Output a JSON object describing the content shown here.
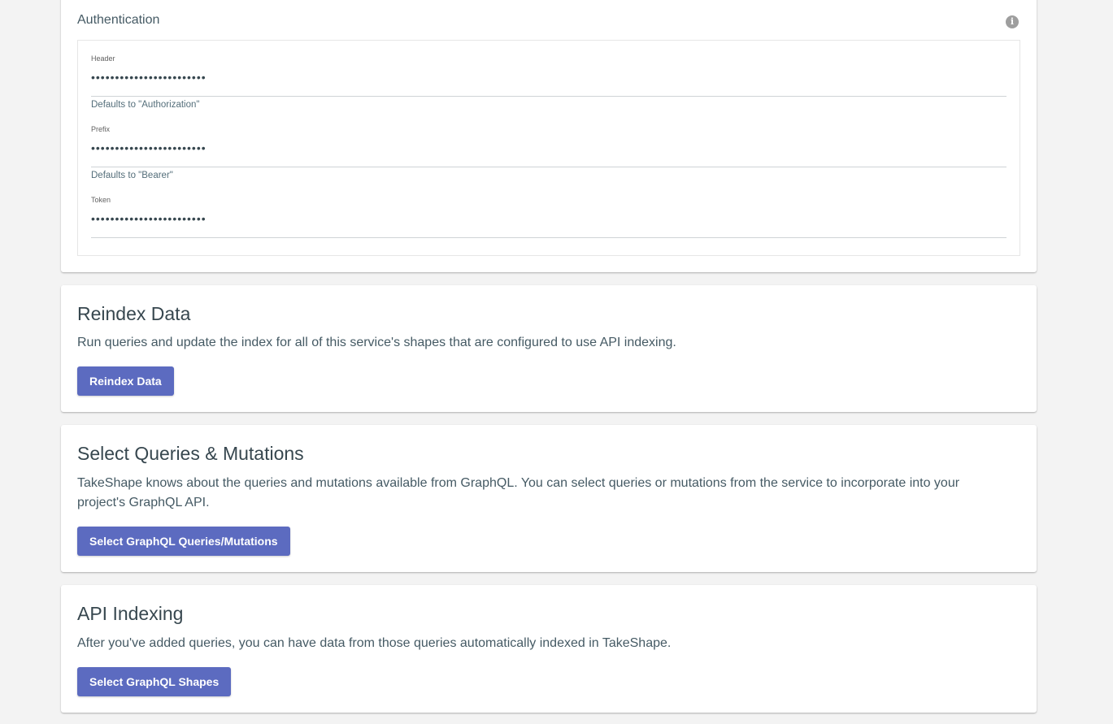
{
  "authentication": {
    "title": "Authentication",
    "info_icon": "info-icon",
    "fields": [
      {
        "label": "Header",
        "value": "••••••••••••••••••••••••",
        "helper": "Defaults to \"Authorization\""
      },
      {
        "label": "Prefix",
        "value": "••••••••••••••••••••••••",
        "helper": "Defaults to \"Bearer\""
      },
      {
        "label": "Token",
        "value": "••••••••••••••••••••••••",
        "helper": ""
      }
    ]
  },
  "reindex": {
    "title": "Reindex Data",
    "description": "Run queries and update the index for all of this service's shapes that are configured to use API indexing.",
    "button_label": "Reindex Data"
  },
  "queries": {
    "title": "Select Queries & Mutations",
    "description": "TakeShape knows about the queries and mutations available from GraphQL. You can select queries or mutations from the service to incorporate into your project's GraphQL API.",
    "button_label": "Select GraphQL Queries/Mutations"
  },
  "indexing": {
    "title": "API Indexing",
    "description": "After you've added queries, you can have data from those queries automatically indexed in TakeShape.",
    "button_label": "Select GraphQL Shapes"
  },
  "colors": {
    "background": "#f3f3f3",
    "card": "#ffffff",
    "button": "#5c6bc0",
    "text": "#37474f"
  }
}
